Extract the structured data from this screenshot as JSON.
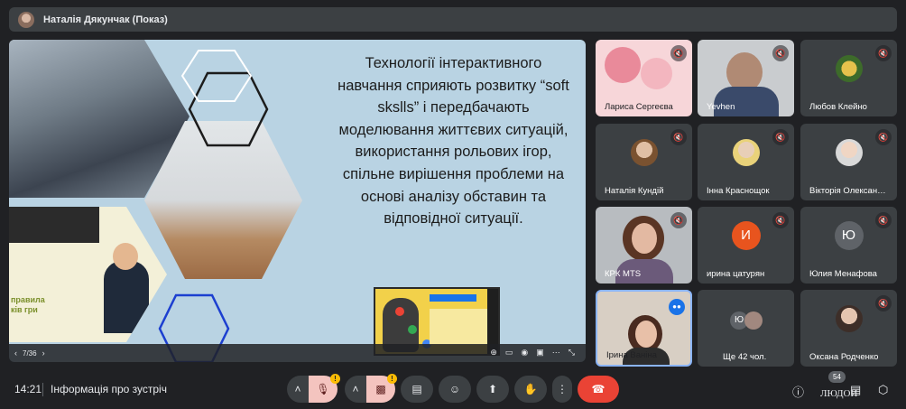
{
  "header": {
    "presenter": "Наталія Дякунчак (Показ)"
  },
  "slide": {
    "text": "Технології  інтерактивного навчання сприяють розвитку “soft skslls” і  передбачають моделювання життєвих ситуацій, використання рольових ігор, спільне вирішення проблеми на основі аналізу обставин та відповідної ситуації.",
    "page_indicator": "7/36",
    "inset_text": "правила ків гри"
  },
  "participants": [
    {
      "name": "Лариса Сергеєва",
      "muted": true
    },
    {
      "name": "Yevhen",
      "muted": true
    },
    {
      "name": "Любов Клейно",
      "muted": true
    },
    {
      "name": "Наталія Кундій",
      "muted": true
    },
    {
      "name": "Інна Краснощок",
      "muted": true
    },
    {
      "name": "Вікторія Олексан…",
      "muted": true
    },
    {
      "name": "КРК MTS",
      "muted": true
    },
    {
      "name": "ирина цатурян",
      "muted": true,
      "initial": "И",
      "color": "#e8541e"
    },
    {
      "name": "Юлия Менафова",
      "muted": true,
      "initial": "Ю",
      "color": "#5f6368"
    },
    {
      "name": "Ірина Ваніна",
      "muted": false
    },
    {
      "name": "Ще 42 чол.",
      "initial": "Ю"
    },
    {
      "name": "Оксана Родченко",
      "muted": true
    }
  ],
  "bottombar": {
    "time": "14:21",
    "meeting_info": "Інформація про зустріч",
    "people_count": "54",
    "people_label": "ЛЮДОИ"
  },
  "colors": {
    "hangup": "#ea4335",
    "active_speaker": "#1a73e8",
    "warning": "#fbbc04"
  }
}
